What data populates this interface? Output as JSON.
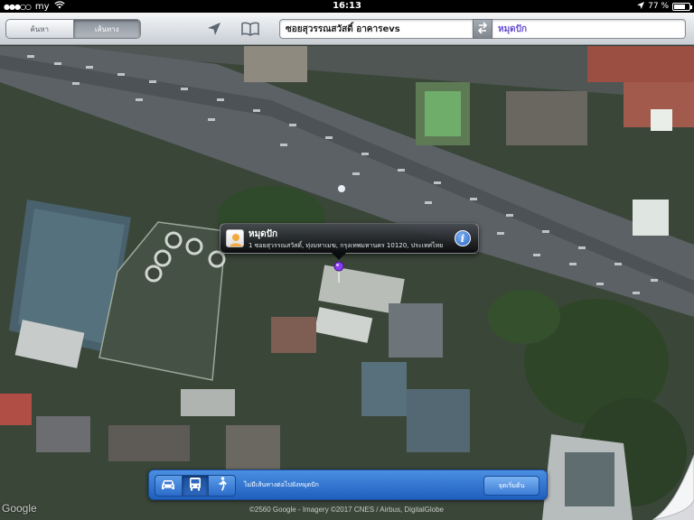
{
  "status_bar": {
    "carrier": "my",
    "time": "16:13",
    "battery_percent": "77 %",
    "battery_level": 0.77
  },
  "toolbar": {
    "mode_tabs": [
      {
        "label": "ค้นหา",
        "active": false
      },
      {
        "label": "เส้นทาง",
        "active": true
      }
    ],
    "icons": [
      "location-arrow-icon",
      "bookmarks-icon"
    ],
    "route": {
      "start": "ซอยสุวรรณสวัสดิ์ อาคารevs",
      "end": "หมุดปัก"
    }
  },
  "callout": {
    "title": "หมุดปัก",
    "address": "1 ซอยสุวรรณสวัสดิ์, ทุ่งมหาเมฆ, กรุงเทพมหานคร 10120, ประเทศไทย"
  },
  "route_bar": {
    "modes": [
      {
        "icon": "car-icon",
        "active": false
      },
      {
        "icon": "bus-icon",
        "active": true
      },
      {
        "icon": "walk-icon",
        "active": false
      }
    ],
    "message": "ไม่มีเส้นทางต่อไปยังหมุดปัก",
    "button_label": "จุดเริ่มต้น"
  },
  "map": {
    "logo": "Google",
    "copyright": "©2560 Google - Imagery ©2017 CNES / Airbus, DigitalGlobe"
  },
  "colors": {
    "route_bar_blue": "#2a6cc8",
    "pin_purple": "#8a3df0"
  }
}
